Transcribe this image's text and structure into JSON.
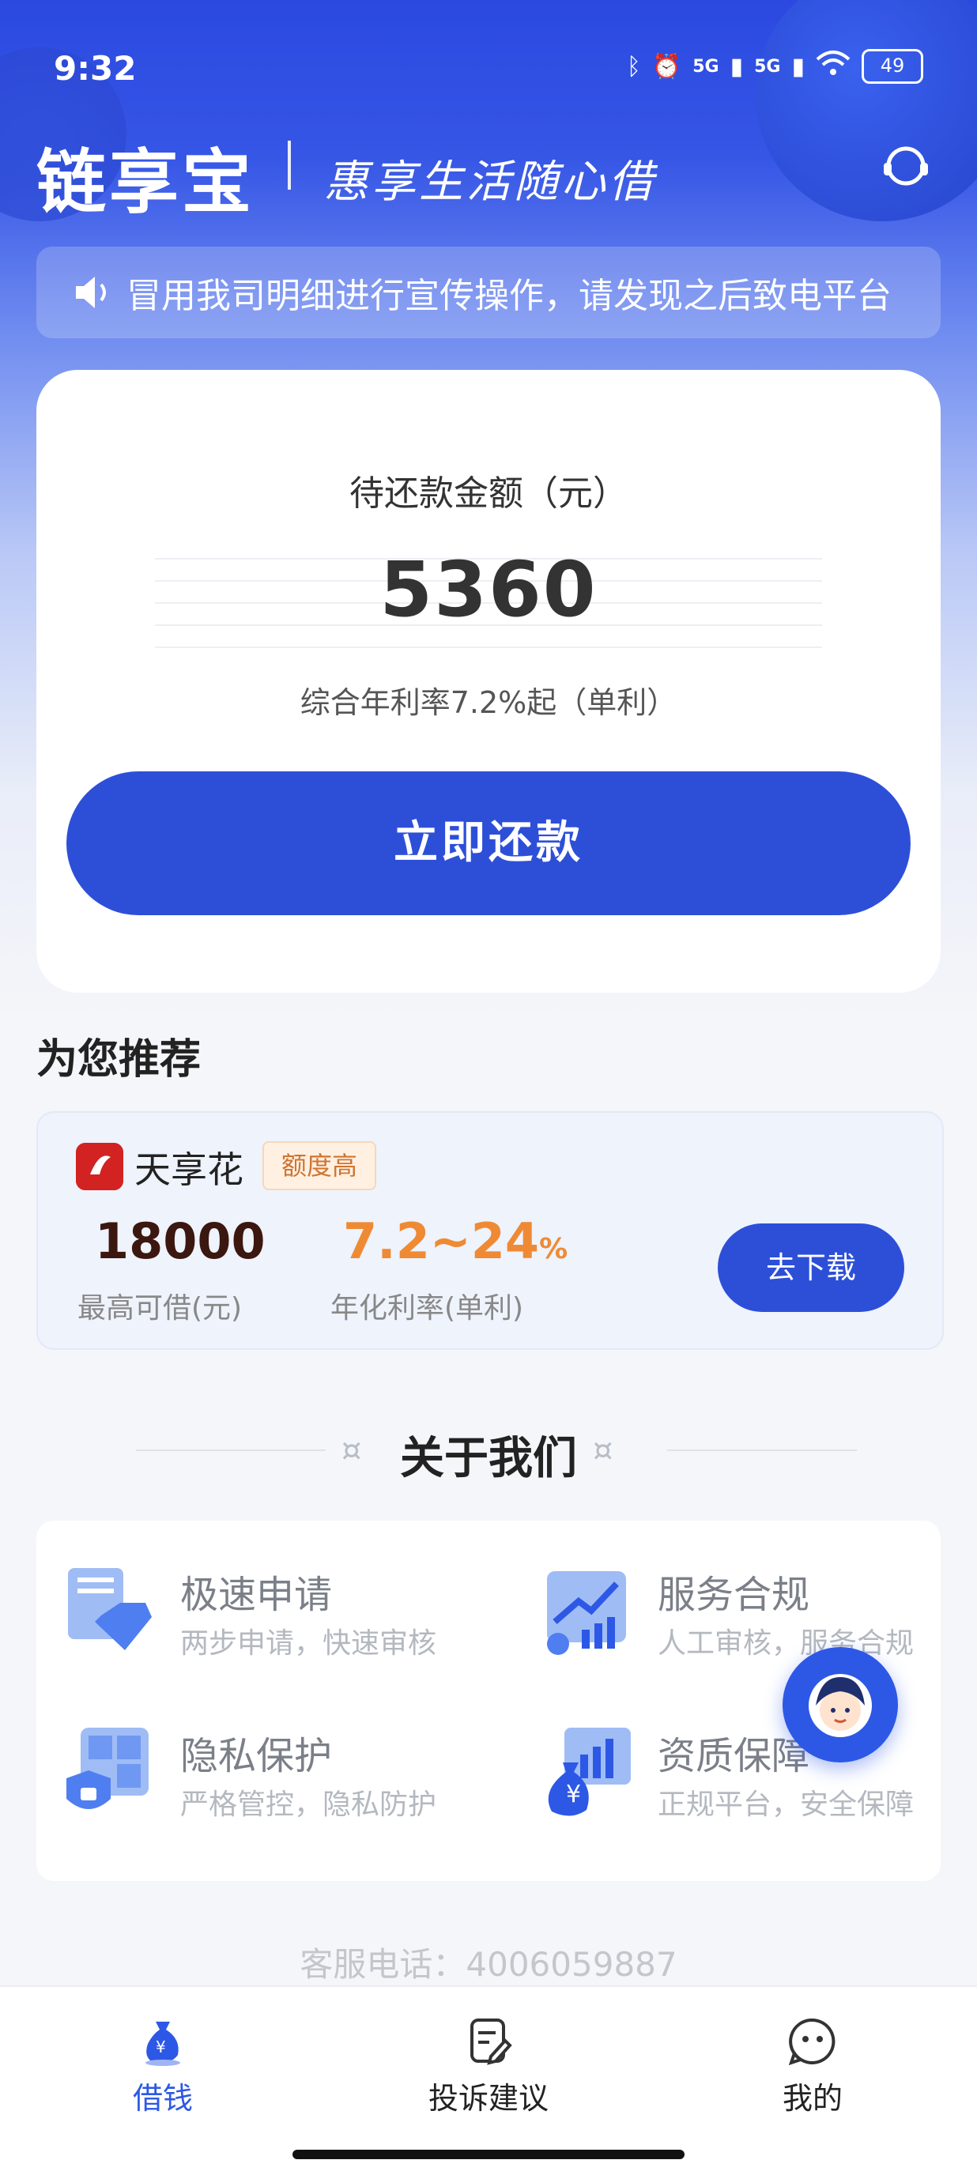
{
  "status_bar": {
    "time": "9:32",
    "network_label_1": "5G",
    "network_label_2": "5G",
    "battery_level": "49"
  },
  "header": {
    "logo": "链享宝",
    "slogan": "惠享生活随心借",
    "customer_service_icon": "headset-icon"
  },
  "notice": {
    "icon": "speaker-icon",
    "text": "冒用我司明细进行宣传操作，请发现之后致电平台"
  },
  "repayment_card": {
    "label": "待还款金额（元）",
    "amount": "5360",
    "rate_text": "综合年利率7.2%起（单利）",
    "button_label": "立即还款"
  },
  "recommend": {
    "section_title": "为您推荐",
    "product": {
      "name": "天享花",
      "tag": "额度高",
      "max_amount": "18000",
      "max_amount_label": "最高可借(元)",
      "rate_value": "7.2~24",
      "rate_unit": "%",
      "rate_label": "年化利率(单利)",
      "button_label": "去下载"
    }
  },
  "about": {
    "title": "关于我们",
    "features": [
      {
        "title": "极速申请",
        "subtitle": "两步申请，快速审核",
        "icon": "document-diamond-icon"
      },
      {
        "title": "服务合规",
        "subtitle": "人工审核，服务合规",
        "icon": "chart-growth-icon"
      },
      {
        "title": "隐私保护",
        "subtitle": "严格管控，隐私防护",
        "icon": "lock-shield-icon"
      },
      {
        "title": "资质保障",
        "subtitle": "正规平台，安全保障",
        "icon": "money-bag-icon"
      }
    ]
  },
  "footer": {
    "phone_text": "客服电话：4006059887"
  },
  "tabbar": {
    "tabs": [
      {
        "label": "借钱",
        "active": true,
        "icon": "money-bag-icon"
      },
      {
        "label": "投诉建议",
        "active": false,
        "icon": "edit-document-icon"
      },
      {
        "label": "我的",
        "active": false,
        "icon": "smile-face-icon"
      }
    ]
  },
  "colors": {
    "primary": "#2d4fd8",
    "accent_orange": "#ef8a34",
    "dark_amount": "#3b1710"
  }
}
